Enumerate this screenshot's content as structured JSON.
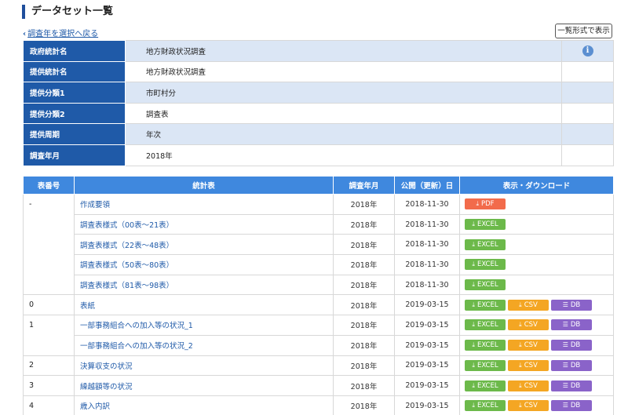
{
  "header": {
    "title": "データセット一覧",
    "back_label": "調査年を選択へ戻る",
    "list_view_label": "一覧形式で表示"
  },
  "info_rows": [
    {
      "key": "政府統計名",
      "value": "地方財政状況調査"
    },
    {
      "key": "提供統計名",
      "value": "地方財政状況調査"
    },
    {
      "key": "提供分類1",
      "value": "市町村分"
    },
    {
      "key": "提供分類2",
      "value": "調査表"
    },
    {
      "key": "提供周期",
      "value": "年次"
    },
    {
      "key": "調査年月",
      "value": "2018年"
    }
  ],
  "table": {
    "headers": {
      "no": "表番号",
      "title": "統計表",
      "ym": "調査年月",
      "pub": "公開（更新）日",
      "dl": "表示・ダウンロード"
    },
    "rows": [
      {
        "no": "-",
        "title": "作成要領",
        "ym": "2018年",
        "pub": "2018-11-30",
        "buttons": [
          "PDF"
        ]
      },
      {
        "no": "",
        "title": "調査表様式（00表～21表）",
        "ym": "2018年",
        "pub": "2018-11-30",
        "buttons": [
          "EXCEL"
        ]
      },
      {
        "no": "",
        "title": "調査表様式（22表～48表）",
        "ym": "2018年",
        "pub": "2018-11-30",
        "buttons": [
          "EXCEL"
        ]
      },
      {
        "no": "",
        "title": "調査表様式（50表～80表）",
        "ym": "2018年",
        "pub": "2018-11-30",
        "buttons": [
          "EXCEL"
        ]
      },
      {
        "no": "",
        "title": "調査表様式（81表～98表）",
        "ym": "2018年",
        "pub": "2018-11-30",
        "buttons": [
          "EXCEL"
        ]
      },
      {
        "no": "0",
        "title": "表紙",
        "ym": "2018年",
        "pub": "2019-03-15",
        "buttons": [
          "EXCEL",
          "CSV",
          "DB"
        ]
      },
      {
        "no": "1",
        "title": "一部事務組合への加入等の状況_1",
        "ym": "2018年",
        "pub": "2019-03-15",
        "buttons": [
          "EXCEL",
          "CSV",
          "DB"
        ]
      },
      {
        "no": "",
        "title": "一部事務組合への加入等の状況_2",
        "ym": "2018年",
        "pub": "2019-03-15",
        "buttons": [
          "EXCEL",
          "CSV",
          "DB"
        ]
      },
      {
        "no": "2",
        "title": "決算収支の状況",
        "ym": "2018年",
        "pub": "2019-03-15",
        "buttons": [
          "EXCEL",
          "CSV",
          "DB"
        ]
      },
      {
        "no": "3",
        "title": "繰越額等の状況",
        "ym": "2018年",
        "pub": "2019-03-15",
        "buttons": [
          "EXCEL",
          "CSV",
          "DB"
        ]
      },
      {
        "no": "4",
        "title": "歳入内訳",
        "ym": "2018年",
        "pub": "2019-03-15",
        "buttons": [
          "EXCEL",
          "CSV",
          "DB"
        ]
      }
    ]
  },
  "icons": {
    "info": "info-icon",
    "download": "download-icon",
    "list": "list-icon",
    "back": "chevron-left-icon"
  },
  "colors": {
    "header_blue": "#1f5aa8",
    "table_header": "#3f88de",
    "pdf": "#f26b4b",
    "excel": "#6cb94a",
    "csv": "#f4a623",
    "db": "#8a63c9"
  }
}
